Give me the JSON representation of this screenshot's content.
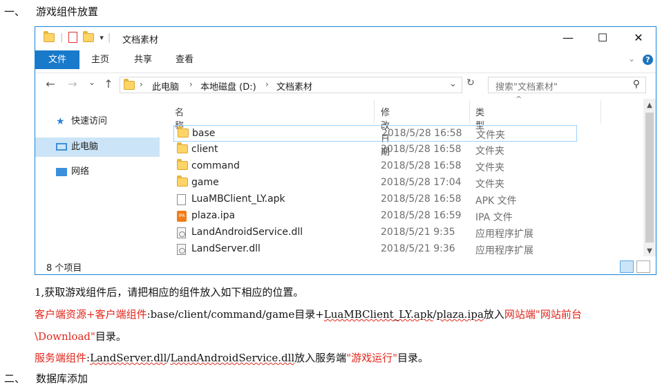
{
  "doc": {
    "heading1": {
      "num": "一、",
      "text": "游戏组件放置"
    },
    "heading2": {
      "num": "二、",
      "text": "数据库添加"
    },
    "step1": "1,获取游戏组件后，请把相应的组件放入如下相应的位置。",
    "client_line": {
      "label": "客户端资源+客户端组件",
      "paths": ":base/client/command/game",
      "mid1": "目录+",
      "apk": "LuaMBClient_LY.apk",
      "slash": "/",
      "ipa": "plaza.ipa",
      "put": "放入",
      "target": "网站端\"网站前台",
      "cont_target": "\\Download\"",
      "cont_end": "目录。"
    },
    "server_line": {
      "label": "服务端组件",
      "colon": ":",
      "dll1": "LandServer.dll",
      "slash": "/",
      "dll2": "LandAndroidService.dll",
      "put": "放入服务端",
      "target": "\"游戏运行\"",
      "end": "目录。"
    }
  },
  "explorer": {
    "title": "文档素材",
    "ribbon_tabs": [
      "文件",
      "主页",
      "共享",
      "查看"
    ],
    "help": "?",
    "window_controls": {
      "minimize": "—",
      "maximize": "☐",
      "close": "✕"
    },
    "nav_buttons": {
      "back": "←",
      "forward": "→",
      "recent": "⌄",
      "up": "↑"
    },
    "breadcrumb": [
      "此电脑",
      "本地磁盘 (D:)",
      "文档素材"
    ],
    "search_placeholder": "搜索\"文档素材\"",
    "nav_pane": [
      "快速访问",
      "此电脑",
      "网络"
    ],
    "columns": {
      "name": "名称",
      "date": "修改日期",
      "type": "类型"
    },
    "files": [
      {
        "name": "base",
        "date": "2018/5/28 16:58",
        "type": "文件夹",
        "icon": "folder-icon"
      },
      {
        "name": "client",
        "date": "2018/5/28 16:58",
        "type": "文件夹",
        "icon": "folder-icon"
      },
      {
        "name": "command",
        "date": "2018/5/28 16:58",
        "type": "文件夹",
        "icon": "folder-icon"
      },
      {
        "name": "game",
        "date": "2018/5/28 17:04",
        "type": "文件夹",
        "icon": "folder-icon"
      },
      {
        "name": "LuaMBClient_LY.apk",
        "date": "2018/5/28 16:58",
        "type": "APK 文件",
        "icon": "file-icon"
      },
      {
        "name": "plaza.ipa",
        "date": "2018/5/28 16:59",
        "type": "IPA 文件",
        "icon": "ipa-file-icon"
      },
      {
        "name": "LandAndroidService.dll",
        "date": "2018/5/21 9:35",
        "type": "应用程序扩展",
        "icon": "dll-file-icon"
      },
      {
        "name": "LandServer.dll",
        "date": "2018/5/21 9:36",
        "type": "应用程序扩展",
        "icon": "dll-file-icon"
      }
    ],
    "status": "8 个项目",
    "colors": {
      "accent": "#1979ca",
      "selection": "#cce4f7",
      "folder": "#ffd466"
    }
  }
}
